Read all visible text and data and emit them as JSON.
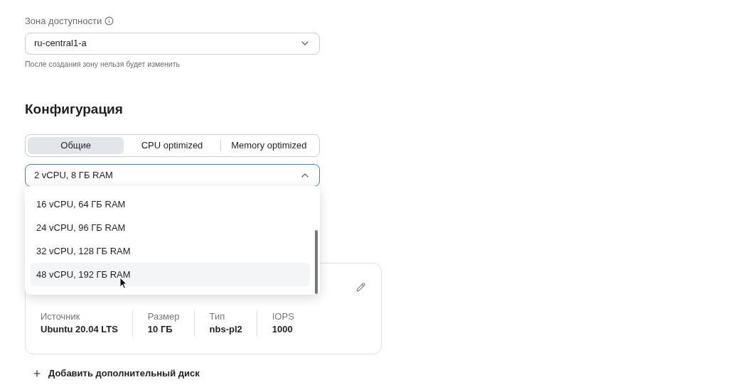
{
  "zone": {
    "label": "Зона доступности",
    "value": "ru-central1-a",
    "hint": "После создания зону нельзя будет изменить"
  },
  "configuration": {
    "title": "Конфигурация",
    "tabs": [
      {
        "label": "Общие",
        "selected": true
      },
      {
        "label": "CPU optimized",
        "selected": false
      },
      {
        "label": "Memory optimized",
        "selected": false
      }
    ],
    "select": {
      "value": "2 vCPU, 8 ГБ RAM",
      "expanded": true
    },
    "options": [
      {
        "label": "16 vCPU, 64 ГБ RAM",
        "highlighted": false
      },
      {
        "label": "24 vCPU, 96 ГБ RAM",
        "highlighted": false
      },
      {
        "label": "32 vCPU, 128 ГБ RAM",
        "highlighted": false
      },
      {
        "label": "48 vCPU, 192 ГБ RAM",
        "highlighted": true
      }
    ]
  },
  "disk": {
    "stats": [
      {
        "label": "Источник",
        "value": "Ubuntu 20.04 LTS"
      },
      {
        "label": "Размер",
        "value": "10 ГБ"
      },
      {
        "label": "Тип",
        "value": "nbs-pl2"
      },
      {
        "label": "IOPS",
        "value": "1000"
      }
    ],
    "add_button": "Добавить дополнительный диск"
  }
}
